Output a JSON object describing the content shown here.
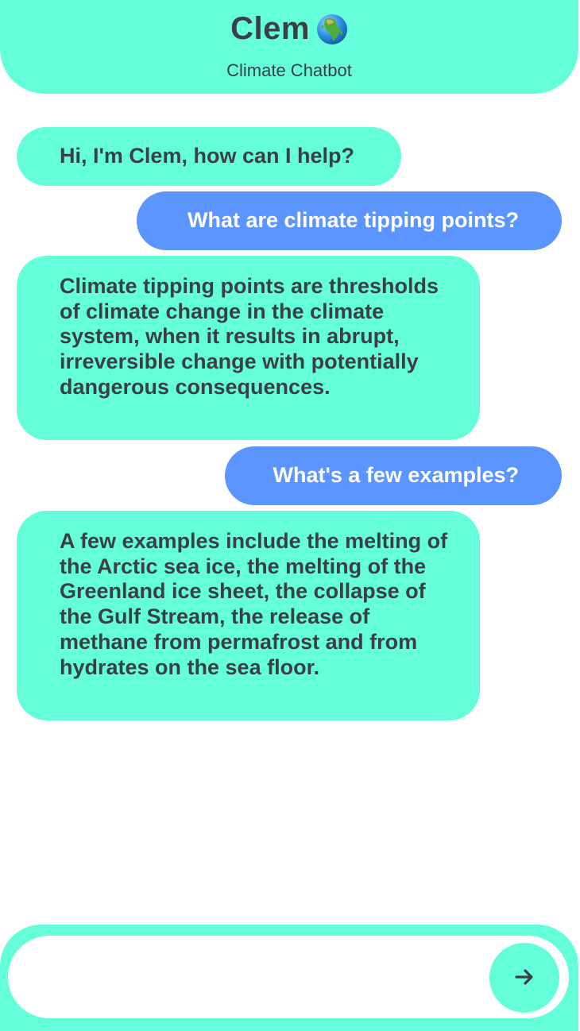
{
  "header": {
    "title": "Clem",
    "globe_icon": "globe-earth-africa-icon",
    "subtitle": "Climate Chatbot"
  },
  "colors": {
    "accent": "#64ffda",
    "user_bubble": "#5c95ff",
    "text_dark": "#3a3f44"
  },
  "messages": [
    {
      "sender": "bot",
      "text": "Hi, I'm Clem, how can I help?"
    },
    {
      "sender": "user",
      "text": "What are climate tipping points?"
    },
    {
      "sender": "bot",
      "text": "Climate tipping points are thresholds of climate change in the climate system, when it results in abrupt, irreversible change with potentially dangerous consequences."
    },
    {
      "sender": "user",
      "text": "What's a few examples?"
    },
    {
      "sender": "bot",
      "text": "A few examples include the melting of the Arctic sea ice, the melting of the Greenland ice sheet, the collapse of the Gulf Stream, the release of methane from permafrost and from hydrates on the sea floor."
    }
  ],
  "composer": {
    "value": "",
    "placeholder": "",
    "send_icon": "arrow-right-icon"
  }
}
